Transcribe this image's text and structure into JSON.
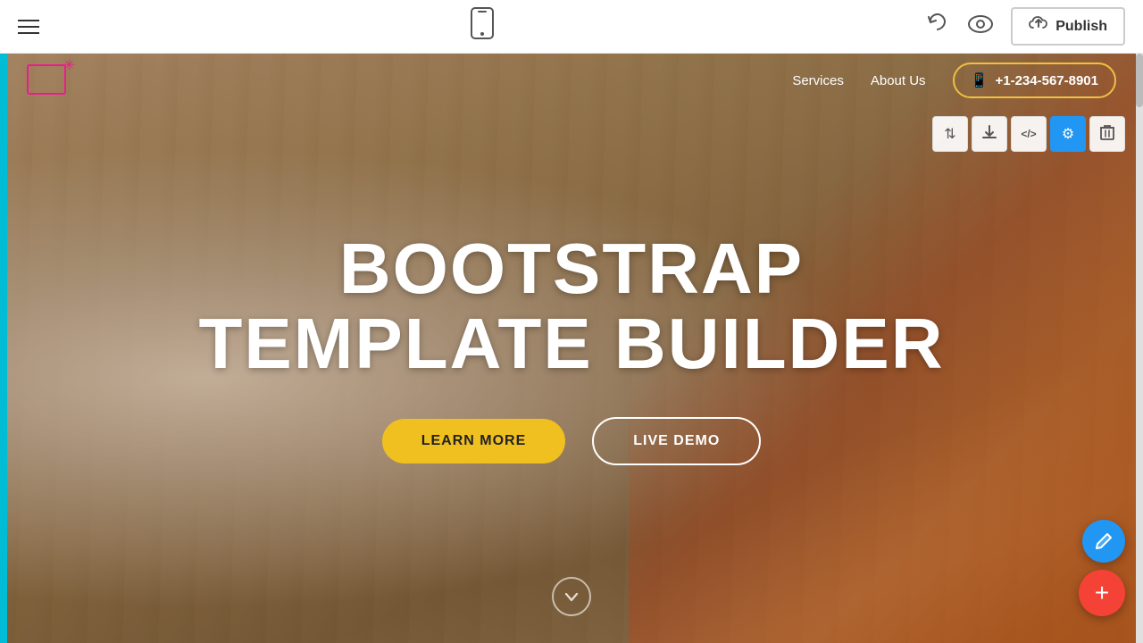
{
  "toolbar": {
    "hamburger_label": "menu",
    "undo_label": "↺",
    "preview_label": "👁",
    "cloud_label": "☁",
    "publish_label": "Publish",
    "mobile_icon": "📱"
  },
  "site_nav": {
    "services_label": "Services",
    "about_us_label": "About Us",
    "phone": "+1-234-567-8901"
  },
  "hero": {
    "title_line1": "BOOTSTRAP",
    "title_line2": "TEMPLATE BUILDER",
    "btn_learn_more": "LEARN MORE",
    "btn_live_demo": "LIVE DEMO"
  },
  "section_toolbar": {
    "move_icon": "⇅",
    "download_icon": "⬇",
    "code_icon": "</>",
    "settings_icon": "⚙",
    "delete_icon": "🗑"
  },
  "fabs": {
    "edit_icon": "✏",
    "add_icon": "+"
  },
  "colors": {
    "accent_cyan": "#00bcd4",
    "accent_yellow": "#f0c020",
    "accent_blue": "#2196f3",
    "accent_red": "#f44336",
    "logo_pink": "#e91e8c",
    "phone_border": "#f0c040"
  }
}
